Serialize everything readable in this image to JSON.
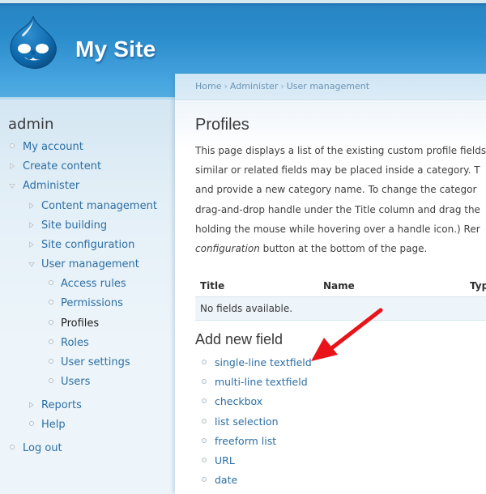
{
  "site": {
    "name": "My Site",
    "logo_icon": "drupal-drop-logo"
  },
  "breadcrumb": [
    "Home",
    "Administer",
    "User management"
  ],
  "breadcrumb_separator": "›",
  "sidebar": {
    "title": "admin",
    "items": [
      {
        "label": "My account",
        "marker": "bullet",
        "level": 0
      },
      {
        "label": "Create content",
        "marker": "collapsed",
        "level": 0
      },
      {
        "label": "Administer",
        "marker": "expanded",
        "level": 0
      },
      {
        "label": "Content management",
        "marker": "collapsed",
        "level": 1
      },
      {
        "label": "Site building",
        "marker": "collapsed",
        "level": 1
      },
      {
        "label": "Site configuration",
        "marker": "collapsed",
        "level": 1
      },
      {
        "label": "User management",
        "marker": "expanded",
        "level": 1
      },
      {
        "label": "Access rules",
        "marker": "bullet",
        "level": 2
      },
      {
        "label": "Permissions",
        "marker": "bullet",
        "level": 2
      },
      {
        "label": "Profiles",
        "marker": "bullet",
        "level": 2,
        "active": true
      },
      {
        "label": "Roles",
        "marker": "bullet",
        "level": 2
      },
      {
        "label": "User settings",
        "marker": "bullet",
        "level": 2
      },
      {
        "label": "Users",
        "marker": "bullet",
        "level": 2
      },
      {
        "label": "Reports",
        "marker": "collapsed",
        "level": 1
      },
      {
        "label": "Help",
        "marker": "bullet",
        "level": 1
      },
      {
        "label": "Log out",
        "marker": "bullet",
        "level": 0
      }
    ]
  },
  "main": {
    "title": "Profiles",
    "description_lines": [
      "This page displays a list of the existing custom profile fields",
      "similar or related fields may be placed inside a category. T",
      "and provide a new category name. To change the categor",
      "drag-and-drop handle under the Title column and drag the",
      "holding the mouse while hovering over a handle icon.) Rer"
    ],
    "description_last_em": "configuration",
    "description_last_rest": " button at the bottom of the page.",
    "table": {
      "columns": [
        "Title",
        "Name",
        "Typ"
      ],
      "empty_message": "No fields available."
    },
    "add_section_title": "Add new field",
    "field_types": [
      "single-line textfield",
      "multi-line textfield",
      "checkbox",
      "list selection",
      "freeform list",
      "URL",
      "date"
    ],
    "annotation": {
      "type": "red-arrow",
      "points_to": "single-line textfield",
      "color": "#e8141a"
    }
  },
  "colors": {
    "header_blue": "#2b8ccc",
    "link": "#2c6ea3",
    "sidebar_bg": "#edf5fa"
  }
}
